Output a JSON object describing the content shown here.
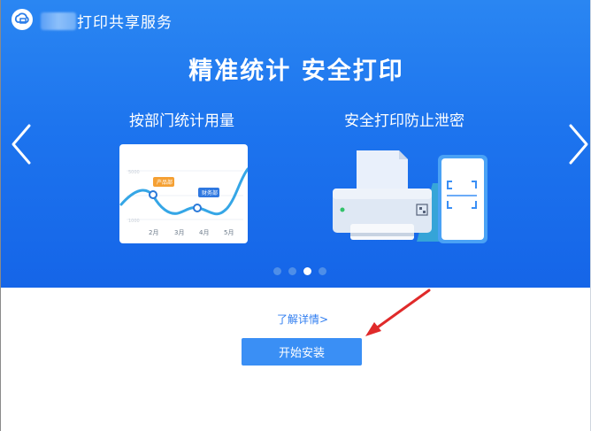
{
  "window": {
    "title": "打印共享服务"
  },
  "banner": {
    "headline": "精准统计  安全打印",
    "features": [
      {
        "label": "按部门统计用量"
      },
      {
        "label": "安全打印防止泄密"
      }
    ],
    "chart": {
      "tags": [
        "产品部",
        "财务部"
      ],
      "y_labels": [
        "5000",
        "1000"
      ],
      "months": [
        "2月",
        "3月",
        "4月",
        "5月"
      ]
    },
    "slide_count": 4,
    "active_slide": 2
  },
  "footer": {
    "learn_more": "了解详情>",
    "install": "开始安装"
  },
  "colors": {
    "banner": "#1d74ee",
    "button": "#3a8ff5",
    "link": "#2f7df0",
    "annotation_arrow": "#e02a2a"
  }
}
